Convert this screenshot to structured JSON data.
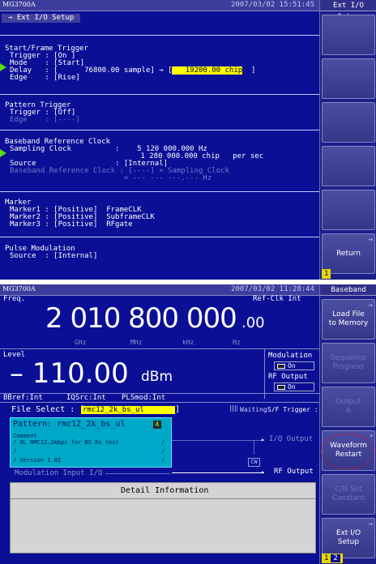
{
  "top": {
    "logo": "MG3700A",
    "clock": "2007/03/02  15:51:45",
    "softkey_title": "Ext I/O Setup",
    "tab_label": "→ Ext I/O Setup",
    "start_frame": {
      "heading": "Start/Frame Trigger",
      "trigger": "Trigger : [On ]",
      "mode": "Mode    : [Start]",
      "delay_prefix": "Delay   : [      76800.00 sample] → [",
      "delay_chip": "   19200.00 chip",
      "delay_suffix": "  ]",
      "edge": "Edge    : [Rise]"
    },
    "pattern_trigger": {
      "heading": "Pattern Trigger",
      "trigger": "Trigger : [Off]",
      "edge": "Edge    : [----]"
    },
    "baseband_clock": {
      "heading": "Baseband Reference Clock",
      "sampling": "Sampling Clock          :    5 120 000.000 Hz",
      "chip": "                                1 280 000.000 chip   per sec",
      "source": "Source                  : [Internal]",
      "bb_ref": "Baseband Reference Clock : [----] × Sampling Clock",
      "bb_hz": "                          = --- --- ---.--- Hz"
    },
    "marker": {
      "heading": "Marker",
      "m1": "Marker1 : [Positive]  FrameCLK",
      "m2": "Marker2 : [Positive]  SubframeCLK",
      "m3": "Marker3 : [Positive]  RFgate"
    },
    "pulse": {
      "heading": "Pulse Modulation",
      "source": "Source  : [Internal]"
    },
    "return_label": "Return",
    "page_indicator": "1"
  },
  "bottom": {
    "logo": "MG3700A",
    "clock": "2007/03/02  11:28:44",
    "softkey_title": "Baseband",
    "freq_label": "Freq.",
    "ref_clk": "Ref-Clk Int",
    "freq_main": "2 010 800 000",
    "freq_dec": ".00",
    "freq_units": [
      "GHz",
      "MHz",
      "kHz",
      "Hz"
    ],
    "level_label": "Level",
    "level_value": "– 110.00",
    "level_unit": "dBm",
    "modulation_label": "Modulation",
    "modulation_state": "On",
    "rf_output_label": "RF Output",
    "rf_output_state": "On",
    "status_bbref": "BBref:Int",
    "status_iqsrc": "IQSrc:Int",
    "status_plsmod": "PLSmod:Int",
    "file_select_label": "File Select : [",
    "file_select_value": "rmc12_2k_bs_ul",
    "file_select_end": "]",
    "waiting": "Waiting",
    "sf_trigger": "S/F Trigger : On",
    "pattern_label": "Pattern: rmc12_2k_bs_ul",
    "pattern_badge": "A",
    "comment_title": "Comment",
    "comment_1": "/ UL RMC12.2kbps for BS Rx test",
    "comment_slash1": "/",
    "comment_2": "/",
    "comment_slash2": "/",
    "comment_3": "/ Version 1.02",
    "comment_slash3": "/",
    "iq_output": "I/Q Output",
    "cw_label": "CW",
    "rf_output_path": "RF Output",
    "mod_input": "Modulation Input I/Q",
    "detail_title": "Detail Information",
    "softkeys": [
      {
        "label": "Load File\nto Memory",
        "dim": false
      },
      {
        "label": "Sequence\nProgress",
        "dim": true
      },
      {
        "label": "Output\nA",
        "dim": true
      },
      {
        "label": "Waveform\nRestart",
        "dim": false
      },
      {
        "label": "C/N Set\nConstant",
        "dim": true
      },
      {
        "label": "Ext I/O\nSetup",
        "dim": false
      }
    ],
    "page_indicator": "1",
    "page_indicator_2": "2"
  },
  "colors": {
    "screen_bg": "#0a0f96",
    "highlight": "#ffff00",
    "pattern_bg": "#00a8c8",
    "indicator": "#55dd00",
    "annotation_circle": "#d0102a"
  }
}
